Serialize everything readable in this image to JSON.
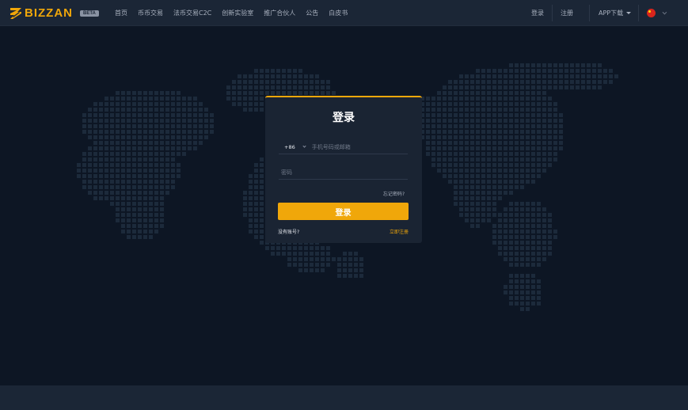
{
  "header": {
    "logo_text": "BIZZAN",
    "badge": "BETA",
    "nav": [
      "首页",
      "币币交易",
      "法币交易C2C",
      "创新实验室",
      "推广合伙人",
      "公告",
      "白皮书"
    ],
    "login": "登录",
    "register": "注册",
    "app_download": "APP下载",
    "language_flag": "china-flag-icon"
  },
  "login_card": {
    "title": "登录",
    "country_code": "+86",
    "phone_placeholder": "手机号码或邮箱",
    "password_placeholder": "密码",
    "forgot": "忘记密码?",
    "submit": "登录",
    "no_account": "没有账号?",
    "register_now": "立即注册"
  },
  "colors": {
    "accent": "#f0a70a",
    "background": "#0d1624",
    "header": "#1b2636",
    "card": "#1a2433",
    "map_dots": "#1c2a3b"
  }
}
